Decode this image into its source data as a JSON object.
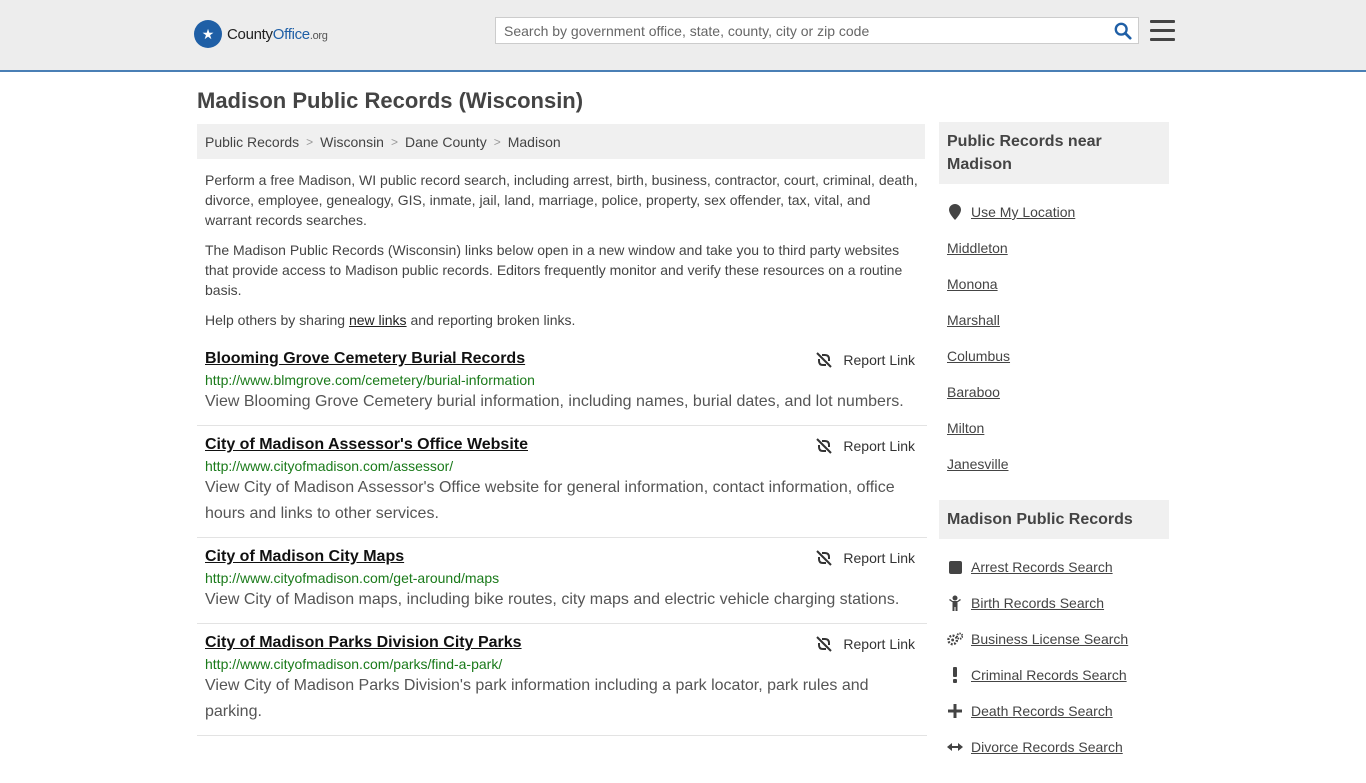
{
  "header": {
    "logo_text_a": "County",
    "logo_text_b": "Office",
    "logo_text_c": ".org",
    "search_placeholder": "Search by government office, state, county, city or zip code"
  },
  "page_title": "Madison Public Records (Wisconsin)",
  "breadcrumb": [
    "Public Records",
    "Wisconsin",
    "Dane County",
    "Madison"
  ],
  "intro": {
    "p1": "Perform a free Madison, WI public record search, including arrest, birth, business, contractor, court, criminal, death, divorce, employee, genealogy, GIS, inmate, jail, land, marriage, police, property, sex offender, tax, vital, and warrant records searches.",
    "p2": "The Madison Public Records (Wisconsin) links below open in a new window and take you to third party websites that provide access to Madison public records. Editors frequently monitor and verify these resources on a routine basis.",
    "p3_before": "Help others by sharing ",
    "p3_link": "new links",
    "p3_after": " and reporting broken links."
  },
  "report_label": "Report Link",
  "links": [
    {
      "title": "Blooming Grove Cemetery Burial Records",
      "url": "http://www.blmgrove.com/cemetery/burial-information",
      "desc": "View Blooming Grove Cemetery burial information, including names, burial dates, and lot numbers."
    },
    {
      "title": "City of Madison Assessor's Office Website",
      "url": "http://www.cityofmadison.com/assessor/",
      "desc": "View City of Madison Assessor's Office website for general information, contact information, office hours and links to other services."
    },
    {
      "title": "City of Madison City Maps",
      "url": "http://www.cityofmadison.com/get-around/maps",
      "desc": "View City of Madison maps, including bike routes, city maps and electric vehicle charging stations."
    },
    {
      "title": "City of Madison Parks Division City Parks",
      "url": "http://www.cityofmadison.com/parks/find-a-park/",
      "desc": "View City of Madison Parks Division's park information including a park locator, park rules and parking."
    }
  ],
  "sidebar": {
    "near_title": "Public Records near Madison",
    "use_location": "Use My Location",
    "near": [
      "Middleton",
      "Monona",
      "Marshall",
      "Columbus",
      "Baraboo",
      "Milton",
      "Janesville"
    ],
    "records_title": "Madison Public Records",
    "records": [
      {
        "label": "Arrest Records Search",
        "icon": "square-icon"
      },
      {
        "label": "Birth Records Search",
        "icon": "baby-icon"
      },
      {
        "label": "Business License Search",
        "icon": "gears-icon"
      },
      {
        "label": "Criminal Records Search",
        "icon": "exclamation-icon"
      },
      {
        "label": "Death Records Search",
        "icon": "cross-icon"
      },
      {
        "label": "Divorce Records Search",
        "icon": "arrows-horizontal-icon"
      }
    ]
  }
}
